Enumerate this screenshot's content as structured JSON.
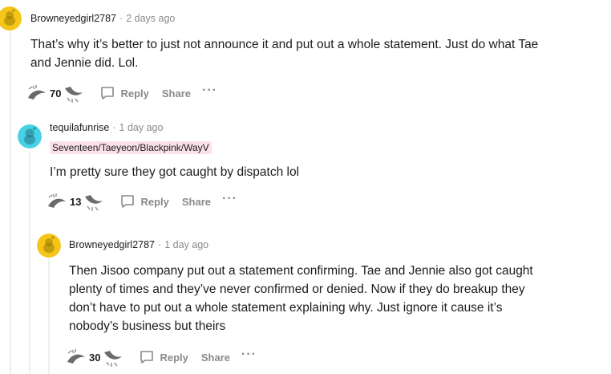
{
  "comments": [
    {
      "author": "Browneyedgirl2787",
      "time": "2 days ago",
      "avatar": "snoo-avatar-yellow",
      "body": [
        "That’s why it’s better to just not announce it and put out a whole statement. Just do what Tae",
        "and Jennie did. Lol."
      ],
      "votes": "70",
      "reply": "Reply",
      "share": "Share",
      "more": "···"
    },
    {
      "author": "tequilafunrise",
      "time": "1 day ago",
      "avatar": "snoo-avatar-teal",
      "flair": "Seventeen/Taeyeon/Blackpink/WayV",
      "body": [
        "I’m pretty sure they got caught by dispatch lol"
      ],
      "votes": "13",
      "reply": "Reply",
      "share": "Share",
      "more": "···"
    },
    {
      "author": "Browneyedgirl2787",
      "time": "1 day ago",
      "avatar": "snoo-avatar-yellow",
      "body": [
        "Then Jisoo company put out a statement confirming. Tae and Jennie also got caught",
        "plenty of times and they’ve never confirmed or denied. Now if they do breakup they",
        "don’t have to put out a whole statement explaining why. Just ignore it cause it’s",
        "nobody’s business but theirs"
      ],
      "votes": "30",
      "reply": "Reply",
      "share": "Share",
      "more": "···"
    }
  ],
  "separator": "·",
  "colors": {
    "flair_bg": "#fbe1e9",
    "meta": "#878a8c",
    "thread": "#edeff1",
    "avatar_yellow": "#f5c518",
    "avatar_teal": "#46d1e6"
  }
}
